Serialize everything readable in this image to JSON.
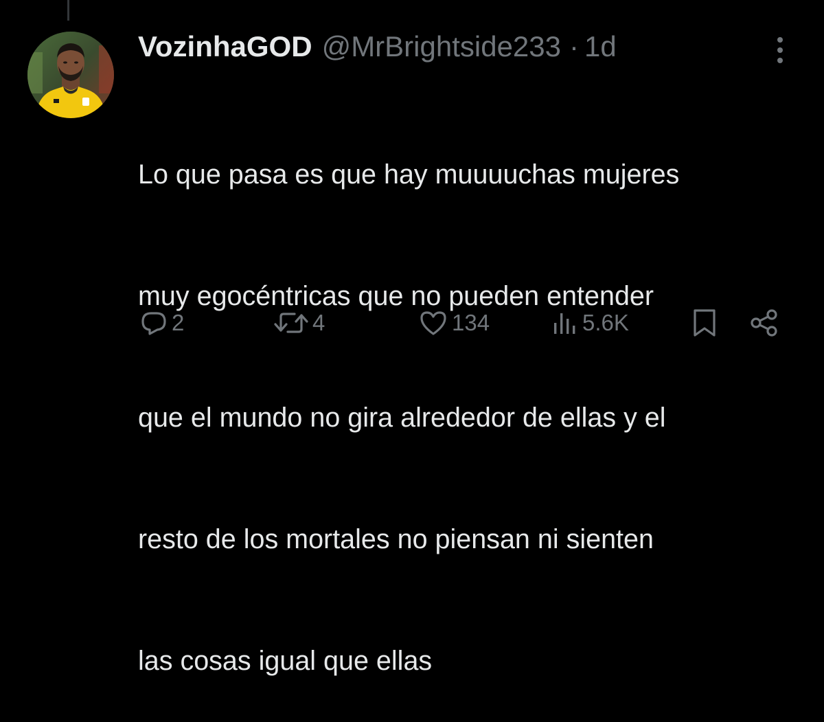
{
  "tweet": {
    "display_name": "VozinhaGOD",
    "handle": "@MrBrightside233",
    "separator": "·",
    "time": "1d",
    "text_lines": [
      "Lo que pasa es que hay muuuuchas mujeres",
      "muy egocéntricas que no pueden entender",
      "que el mundo no gira alrededor de ellas y el",
      "resto de los mortales no piensan ni sienten",
      "las cosas igual que ellas"
    ]
  },
  "actions": {
    "reply_count": "2",
    "retweet_count": "4",
    "like_count": "134",
    "views_count": "5.6K"
  },
  "icons": {
    "reply": "reply-icon",
    "retweet": "retweet-icon",
    "like": "heart-icon",
    "views": "views-icon",
    "bookmark": "bookmark-icon",
    "share": "share-icon",
    "more": "more-dots-icon"
  },
  "colors": {
    "background": "#000000",
    "primary_text": "#e7e9ea",
    "secondary_text": "#71767b",
    "thread_line": "#333639",
    "avatar_jersey": "#f2c70f"
  }
}
